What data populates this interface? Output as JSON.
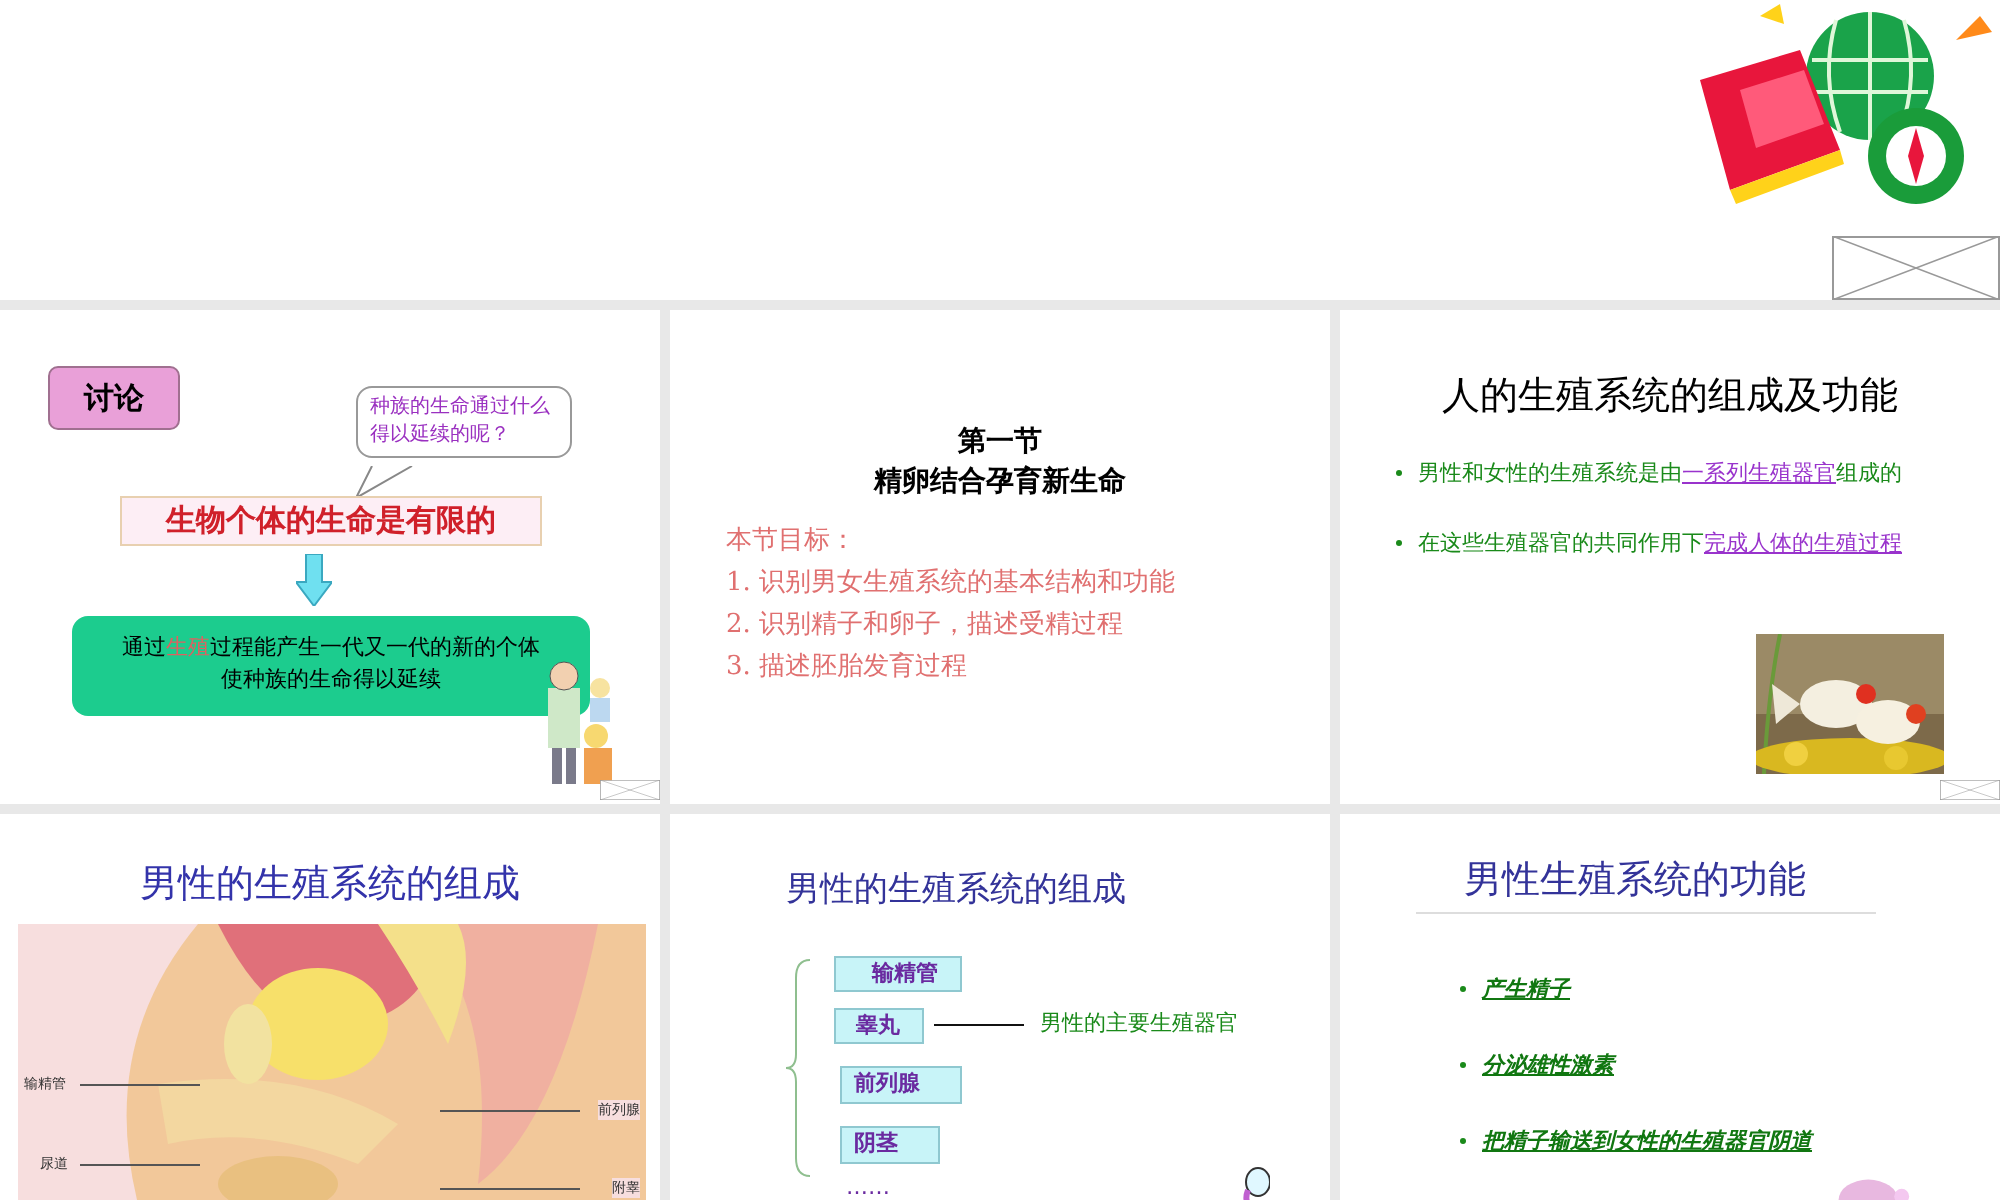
{
  "slides": [
    {
      "kind": "discussion",
      "tag": "讨论",
      "bubble": "种族的生命通过什么得以延续的呢？",
      "banner": "生物个体的生命是有限的",
      "result": {
        "before": "通过",
        "highlight": "生殖",
        "after": "过程能产生一代又一代的新的个体",
        "line2": "使种族的生命得以延续"
      }
    },
    {
      "kind": "objectives",
      "heading": [
        "第一节",
        "精卵结合孕育新生命"
      ],
      "label": "本节目标：",
      "items": [
        "1. 识别男女生殖系统的基本结构和功能",
        "2. 识别精子和卵子，描述受精过程",
        "3. 描述胚胎发育过程"
      ]
    },
    {
      "kind": "bullets",
      "title": "人的生殖系统的组成及功能",
      "bullets": [
        {
          "text": "男性和女性的生殖系统是由",
          "link": "一系列生殖器官",
          "after": "组成的"
        },
        {
          "text": "在这些生殖器官的共同作用下",
          "link": "完成人体的生殖过程"
        }
      ],
      "picture": {
        "kind": "picture"
      }
    },
    {
      "kind": "diagram",
      "title": "男性的生殖系统的组成",
      "labels": [
        "输精管",
        "前列腺",
        "尿道",
        "附睾"
      ]
    },
    {
      "kind": "structure",
      "title": "男性的生殖系统的组成",
      "boxes": [
        "输精管",
        "睾丸",
        "前列腺",
        "阴茎"
      ],
      "note": "男性的主要生殖器官",
      "ellipsis": "……"
    },
    {
      "kind": "functions",
      "title": "男性生殖系统的功能",
      "bullets": [
        "产生精子",
        "分泌雄性激素",
        "把精子输送到女性的生殖器官阴道"
      ]
    }
  ]
}
